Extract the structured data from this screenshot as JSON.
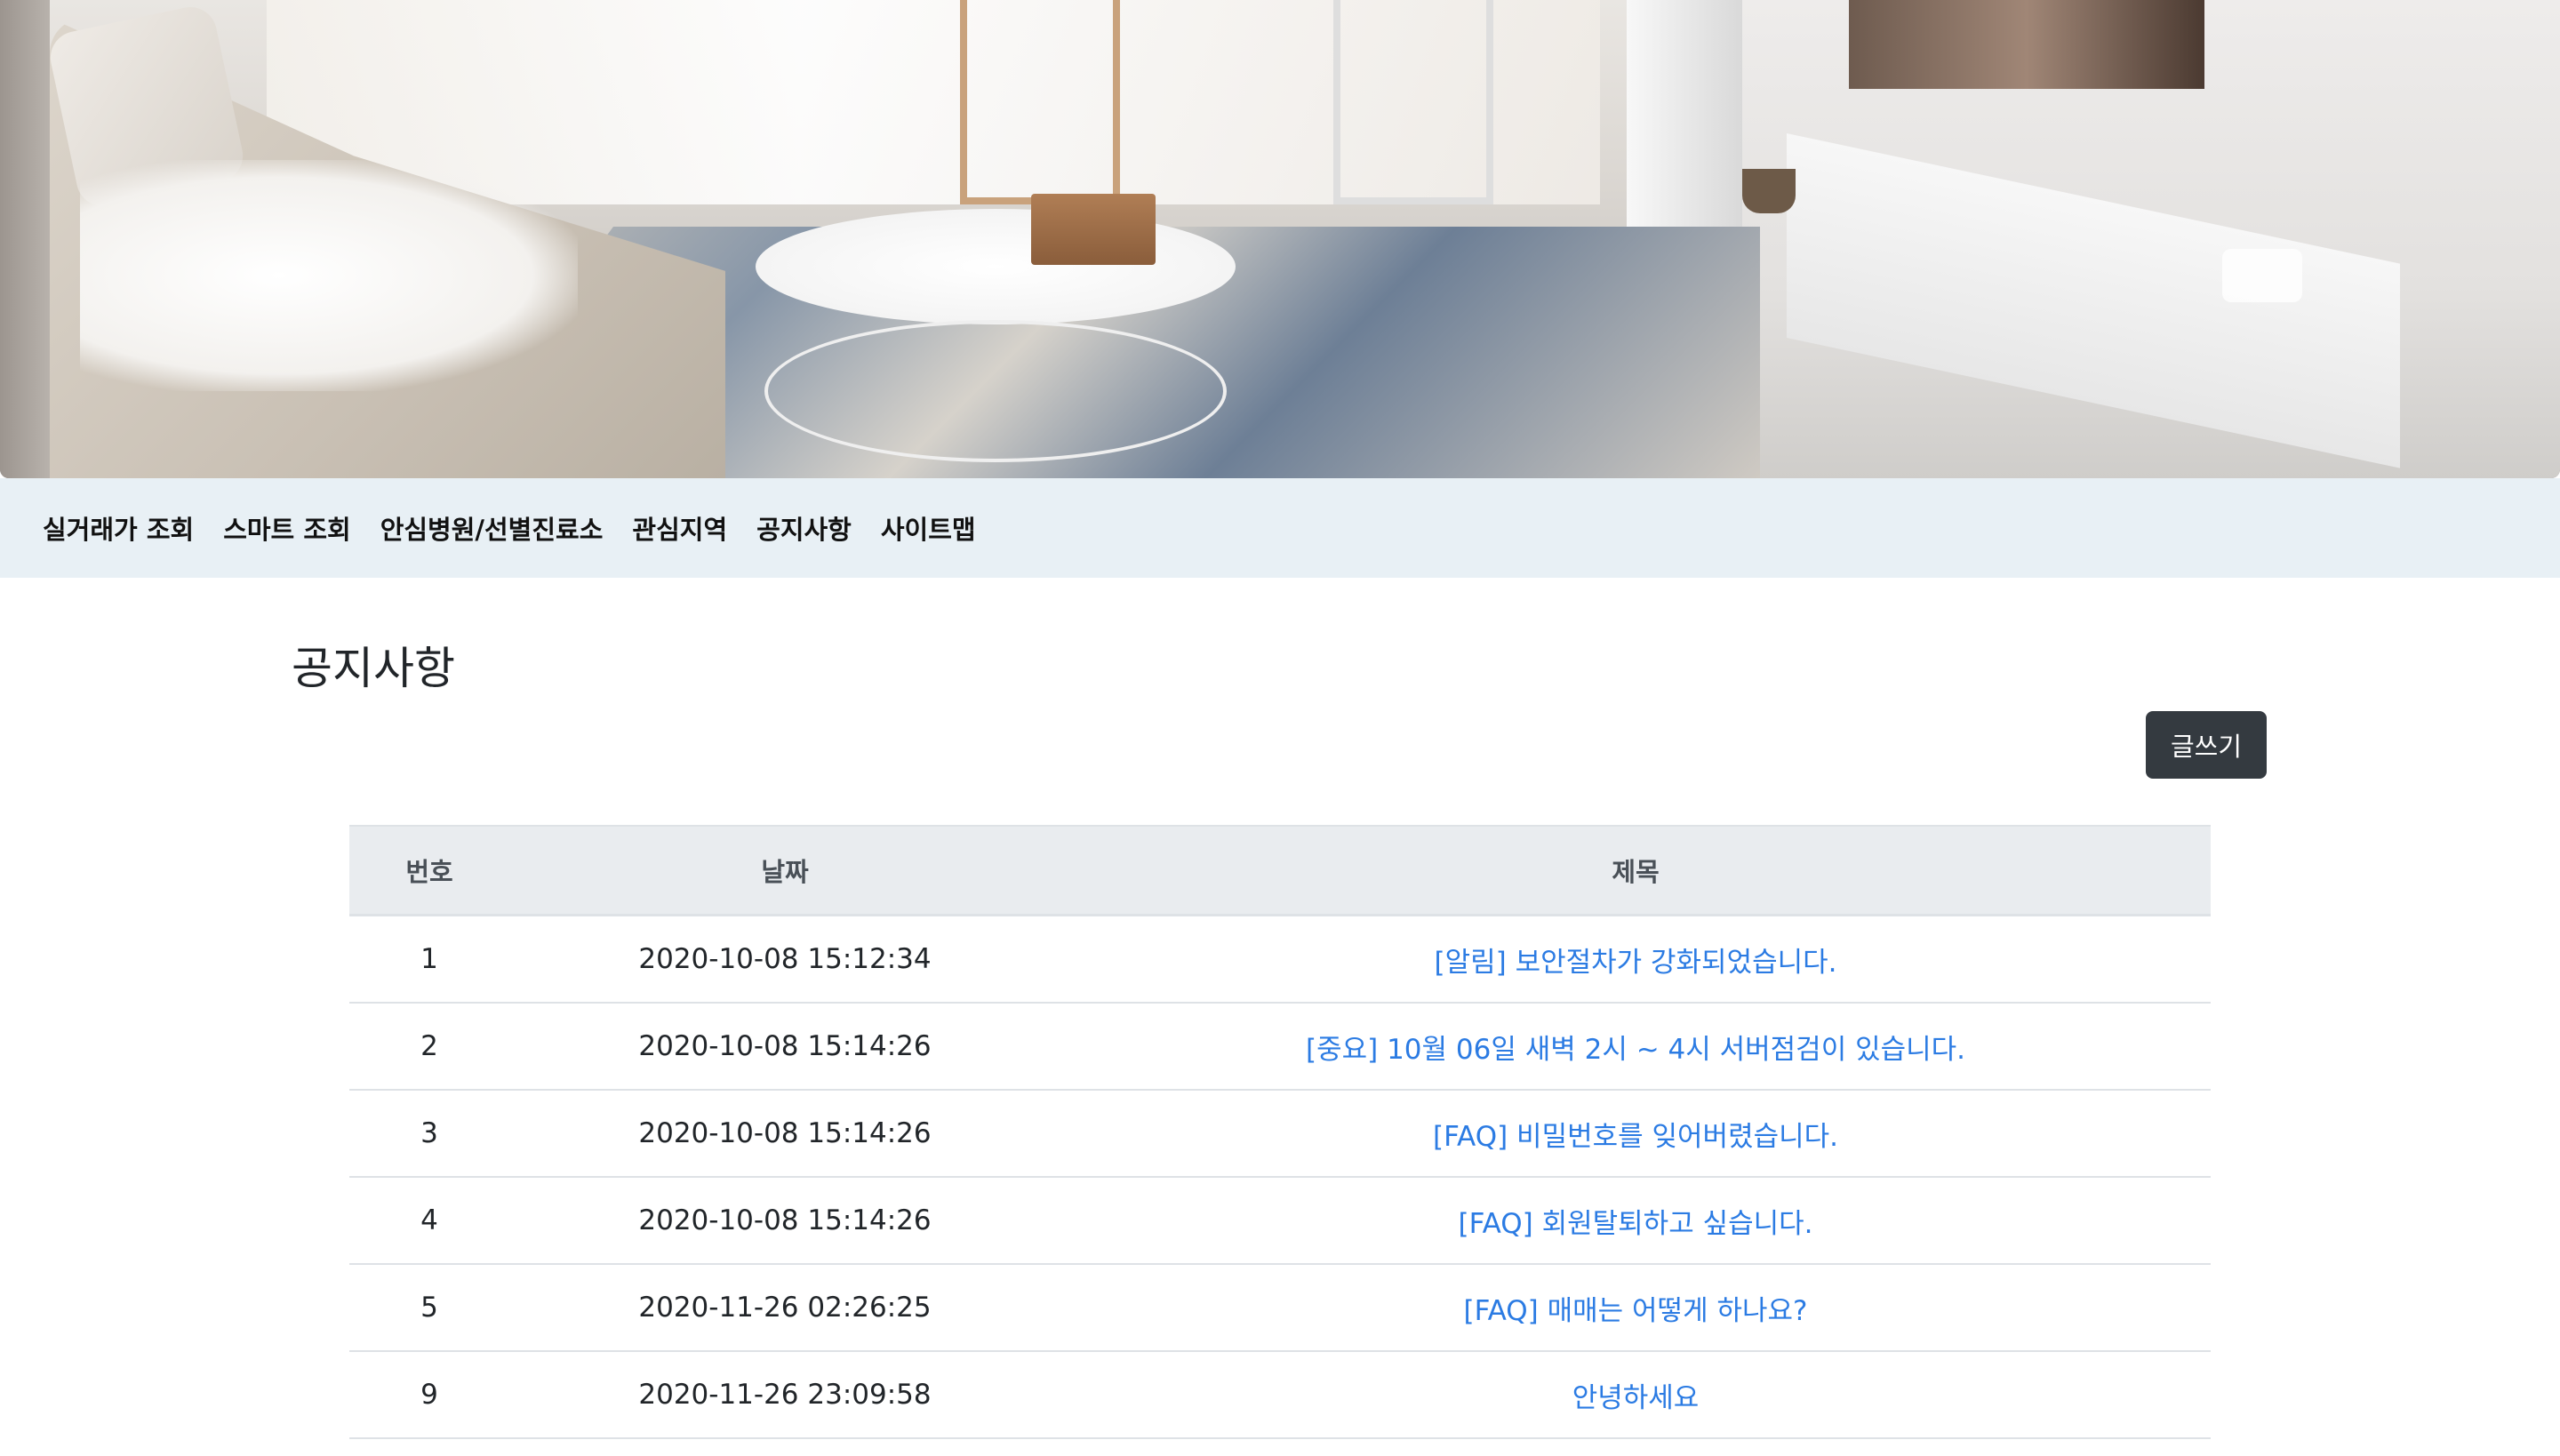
{
  "nav": {
    "items": [
      {
        "label": "실거래가 조회"
      },
      {
        "label": "스마트 조회"
      },
      {
        "label": "안심병원/선별진료소"
      },
      {
        "label": "관심지역"
      },
      {
        "label": "공지사항"
      },
      {
        "label": "사이트맵"
      }
    ]
  },
  "page": {
    "title": "공지사항",
    "write_button": "글쓰기"
  },
  "table": {
    "headers": {
      "number": "번호",
      "date": "날짜",
      "title": "제목"
    },
    "rows": [
      {
        "number": "1",
        "date": "2020-10-08 15:12:34",
        "title": "[알림] 보안절차가 강화되었습니다."
      },
      {
        "number": "2",
        "date": "2020-10-08 15:14:26",
        "title": "[중요] 10월 06일 새벽 2시 ~ 4시 서버점검이 있습니다."
      },
      {
        "number": "3",
        "date": "2020-10-08 15:14:26",
        "title": "[FAQ] 비밀번호를 잊어버렸습니다."
      },
      {
        "number": "4",
        "date": "2020-10-08 15:14:26",
        "title": "[FAQ] 회원탈퇴하고 싶습니다."
      },
      {
        "number": "5",
        "date": "2020-11-26 02:26:25",
        "title": "[FAQ] 매매는 어떻게 하나요?"
      },
      {
        "number": "9",
        "date": "2020-11-26 23:09:58",
        "title": "안녕하세요"
      }
    ]
  },
  "colors": {
    "nav_background": "#e8f0f5",
    "link": "#2b7be3",
    "button": "#343a40",
    "table_header": "#e9ecef"
  }
}
